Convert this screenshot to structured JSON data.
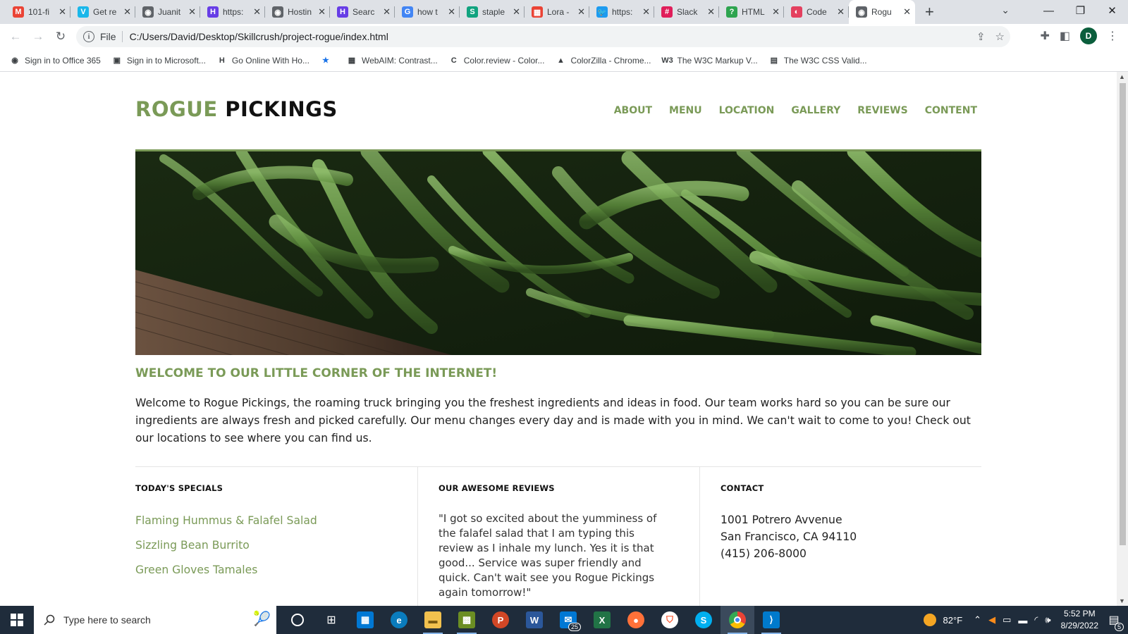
{
  "browser": {
    "tabs": [
      {
        "title": "101-fi",
        "fav": "M",
        "color": "#ea4335"
      },
      {
        "title": "Get re",
        "fav": "V",
        "color": "#1ab7ea"
      },
      {
        "title": "Juanit",
        "fav": "◉",
        "color": "#5f6368"
      },
      {
        "title": "https:",
        "fav": "H",
        "color": "#673de6"
      },
      {
        "title": "Hostin",
        "fav": "◉",
        "color": "#5f6368"
      },
      {
        "title": "Searc",
        "fav": "H",
        "color": "#673de6"
      },
      {
        "title": "how t",
        "fav": "G",
        "color": "#4285f4"
      },
      {
        "title": "staple",
        "fav": "S",
        "color": "#11a37f"
      },
      {
        "title": "Lora -",
        "fav": "▦",
        "color": "#ea4335"
      },
      {
        "title": "https:",
        "fav": "🐦",
        "color": "#1d9bf0"
      },
      {
        "title": "Slack",
        "fav": "#",
        "color": "#e01e5a"
      },
      {
        "title": "HTML",
        "fav": "?",
        "color": "#2ea44f"
      },
      {
        "title": "Code",
        "fav": "◐",
        "color": "#e4405f"
      },
      {
        "title": "Rogu",
        "fav": "◉",
        "color": "#5f6368",
        "active": true
      }
    ],
    "address": {
      "scheme": "File",
      "url": "C:/Users/David/Desktop/Skillcrush/project-rogue/index.html"
    },
    "profile_initial": "D",
    "bookmarks": [
      {
        "label": "Sign in to Office 365",
        "icon": "◉"
      },
      {
        "label": "Sign in to Microsoft...",
        "icon": "▣"
      },
      {
        "label": "Go Online With Ho...",
        "icon": "H"
      },
      {
        "label": "",
        "icon": "★"
      },
      {
        "label": "WebAIM: Contrast...",
        "icon": "▦"
      },
      {
        "label": "Color.review - Color...",
        "icon": "C"
      },
      {
        "label": "ColorZilla - Chrome...",
        "icon": "▲"
      },
      {
        "label": "The W3C Markup V...",
        "icon": "W3"
      },
      {
        "label": "The W3C CSS Valid...",
        "icon": "▤"
      }
    ]
  },
  "site": {
    "logo_green": "ROGUE",
    "logo_black": "PICKINGS",
    "nav": [
      "ABOUT",
      "MENU",
      "LOCATION",
      "GALLERY",
      "REVIEWS",
      "CONTENT"
    ],
    "welcome_heading": "WELCOME TO OUR LITTLE CORNER OF THE INTERNET!",
    "welcome_text": "Welcome to Rogue Pickings, the roaming truck bringing you the freshest ingredients and ideas in food. Our team works hard so you can be sure our ingredients are always fresh and picked carefully. Our menu changes every day and is made with you in mind. We can't wait to come to you! Check out our locations to see where you can find us.",
    "specials_heading": "TODAY'S SPECIALS",
    "specials": [
      "Flaming Hummus & Falafel Salad",
      "Sizzling Bean Burrito",
      "Green Gloves Tamales"
    ],
    "reviews_heading": "OUR AWESOME REVIEWS",
    "review_text": "\"I got so excited about the yumminess of the falafel salad that I am typing this review as I inhale my lunch. Yes it is that good... Service was super friendly and quick. Can't wait see you Rogue Pickings again tomorrow!\"",
    "contact_heading": "CONTACT",
    "contact_lines": [
      "1001 Potrero Avvenue",
      "San Francisco, CA 94110",
      "(415) 206-8000"
    ],
    "accent": "#7a9a57"
  },
  "taskbar": {
    "search_placeholder": "Type here to search",
    "mail_badge": "25",
    "temperature": "82°F",
    "time": "5:52 PM",
    "date": "8/29/2022",
    "notification_count": "5"
  }
}
